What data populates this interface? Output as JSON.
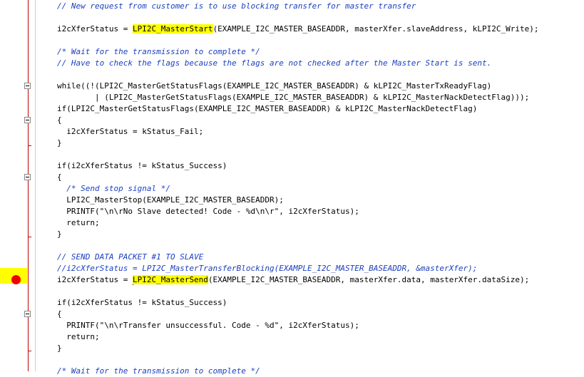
{
  "editor": {
    "breakpoint_line_index": 16,
    "code_lines": [
      {
        "segments": [
          {
            "t": "// New request from customer is to use blocking transfer for master transfer",
            "k": "cmt"
          }
        ]
      },
      {
        "segments": [
          {
            "t": "i2cXferStatus = ",
            "k": ""
          },
          {
            "t": "LPI2C_MasterStart",
            "k": "hl"
          },
          {
            "t": "(EXAMPLE_I2C_MASTER_BASEADDR, masterXfer.slaveAddress, kLPI2C_Write);",
            "k": ""
          }
        ]
      },
      {
        "segments": [
          {
            "t": "/* Wait for the transmission to complete */",
            "k": "cmt"
          }
        ]
      },
      {
        "segments": [
          {
            "t": "// Have to check the flags because the flags are not checked after the Master Start is sent.",
            "k": "cmt"
          }
        ]
      },
      {
        "segments": [
          {
            "t": "while((!(LPI2C_MasterGetStatusFlags(EXAMPLE_I2C_MASTER_BASEADDR) & kLPI2C_MasterTxReadyFlag)",
            "k": ""
          }
        ]
      },
      {
        "segments": [
          {
            "t": "        | (LPI2C_MasterGetStatusFlags(EXAMPLE_I2C_MASTER_BASEADDR) & kLPI2C_MasterNackDetectFlag)));",
            "k": ""
          }
        ]
      },
      {
        "segments": [
          {
            "t": "if(LPI2C_MasterGetStatusFlags(EXAMPLE_I2C_MASTER_BASEADDR) & kLPI2C_MasterNackDetectFlag)",
            "k": ""
          }
        ]
      },
      {
        "segments": [
          {
            "t": "{",
            "k": ""
          }
        ]
      },
      {
        "segments": [
          {
            "t": "  i2cXferStatus = kStatus_Fail;",
            "k": ""
          }
        ]
      },
      {
        "segments": [
          {
            "t": "}",
            "k": ""
          }
        ]
      },
      {
        "segments": [
          {
            "t": "if(i2cXferStatus != kStatus_Success)",
            "k": ""
          }
        ]
      },
      {
        "segments": [
          {
            "t": "{",
            "k": ""
          }
        ]
      },
      {
        "segments": [
          {
            "t": "  ",
            "k": ""
          },
          {
            "t": "/* Send stop signal */",
            "k": "cmt"
          }
        ]
      },
      {
        "segments": [
          {
            "t": "  LPI2C_MasterStop(EXAMPLE_I2C_MASTER_BASEADDR);",
            "k": ""
          }
        ]
      },
      {
        "segments": [
          {
            "t": "  PRINTF(\"\\n\\rNo Slave detected! Code - %d\\n\\r\", i2cXferStatus);",
            "k": ""
          }
        ]
      },
      {
        "segments": [
          {
            "t": "  return;",
            "k": ""
          }
        ]
      },
      {
        "segments": [
          {
            "t": "}",
            "k": ""
          }
        ]
      },
      {
        "segments": [
          {
            "t": "// SEND DATA PACKET #1 TO SLAVE",
            "k": "cmt"
          }
        ]
      },
      {
        "segments": [
          {
            "t": "//i2cXferStatus = LPI2C_MasterTransferBlocking(EXAMPLE_I2C_MASTER_BASEADDR, &masterXfer);",
            "k": "cmt"
          }
        ]
      },
      {
        "segments": [
          {
            "t": "i2cXferStatus = ",
            "k": ""
          },
          {
            "t": "LPI2C_MasterSend",
            "k": "hl"
          },
          {
            "t": "(EXAMPLE_I2C_MASTER_BASEADDR, masterXfer.data, masterXfer.dataSize);",
            "k": ""
          }
        ]
      },
      {
        "segments": [
          {
            "t": "if(i2cXferStatus != kStatus_Success)",
            "k": ""
          }
        ]
      },
      {
        "segments": [
          {
            "t": "{",
            "k": ""
          }
        ]
      },
      {
        "segments": [
          {
            "t": "  PRINTF(\"\\n\\rTransfer unsuccessful. Code - %d\", i2cXferStatus);",
            "k": ""
          }
        ]
      },
      {
        "segments": [
          {
            "t": "  return;",
            "k": ""
          }
        ]
      },
      {
        "segments": [
          {
            "t": "}",
            "k": ""
          }
        ]
      },
      {
        "segments": [
          {
            "t": "/* Wait for the transmission to complete */",
            "k": "cmt"
          }
        ]
      }
    ]
  }
}
